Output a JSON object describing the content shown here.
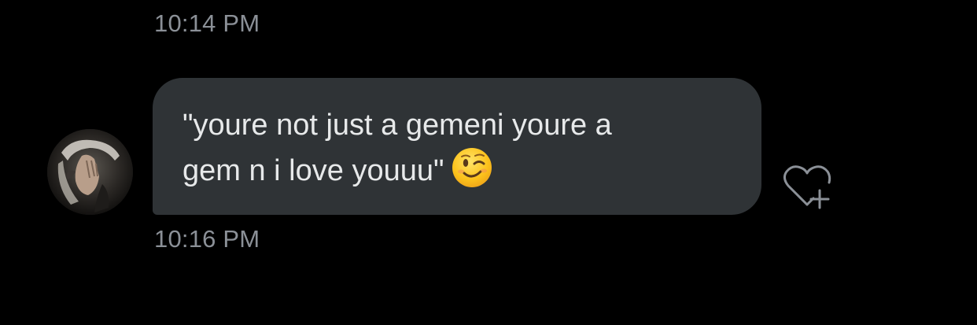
{
  "conversation": {
    "messages": [
      {
        "timestamp": "10:14 PM"
      },
      {
        "sender": "other",
        "text_line_1": "\"youre not just a gemeni youre a",
        "text_line_2": "gem n i love youuu\"",
        "emoji": "winking-face",
        "timestamp": "10:16 PM"
      }
    ]
  },
  "colors": {
    "background": "#000000",
    "bubble": "#2f3336",
    "text": "#e7e9ea",
    "timestamp": "#8b9097",
    "icon": "#8b9097"
  },
  "icons": {
    "react": "heart-plus-icon",
    "emoji": "winking-face-emoji"
  }
}
